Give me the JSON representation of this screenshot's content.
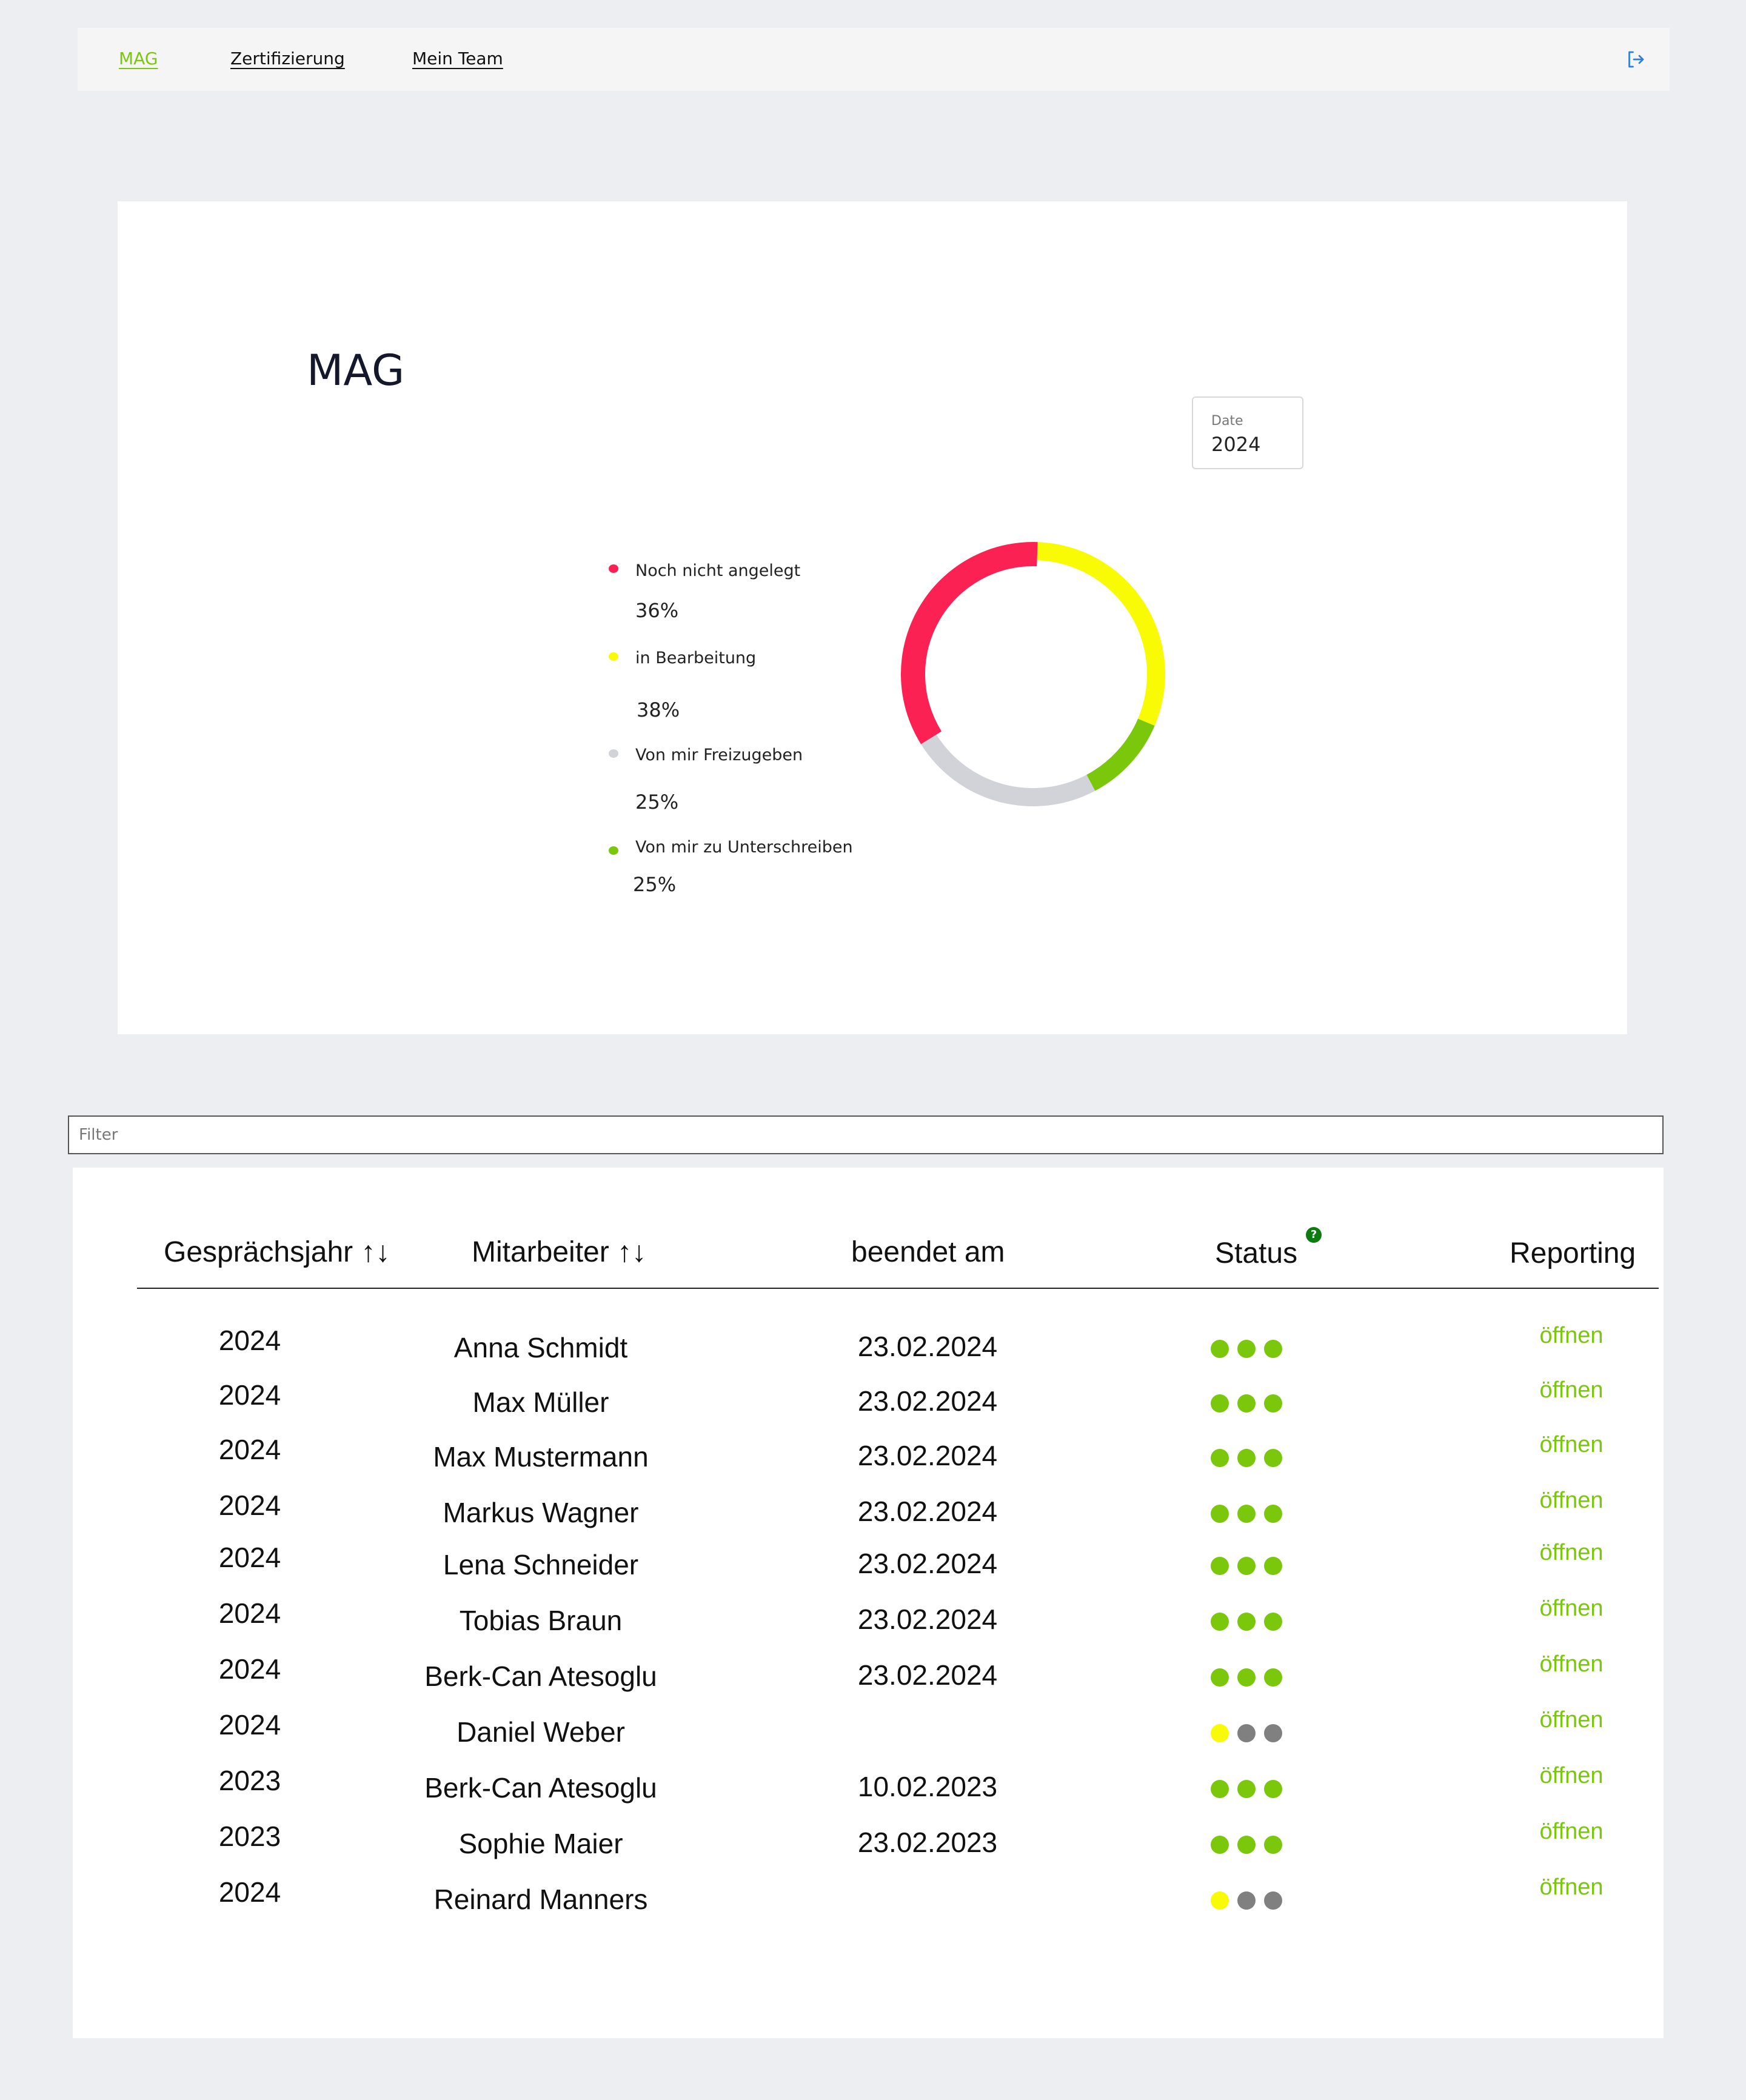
{
  "nav": {
    "items": [
      {
        "label": "MAG",
        "active": true
      },
      {
        "label": "Zertifizierung",
        "active": false
      },
      {
        "label": "Mein Team",
        "active": false
      }
    ],
    "logout_icon": "logout-icon"
  },
  "mag": {
    "title": "MAG",
    "date_label": "Date",
    "date_value": "2024"
  },
  "chart_data": {
    "type": "pie",
    "donut": true,
    "segments": [
      {
        "label": "Noch nicht angelegt",
        "value_label": "36%",
        "value": 36,
        "color": "#fc2153"
      },
      {
        "label": "in Bearbeitung",
        "value_label": "38%",
        "value": 38,
        "color": "#f9fb04"
      },
      {
        "label": "Von mir Freizugeben",
        "value_label": "25%",
        "value": 25,
        "color": "#d1d3d8"
      },
      {
        "label": "Von mir zu Unterschreiben",
        "value_label": "25%",
        "value": 25,
        "color": "#7ac70c"
      }
    ]
  },
  "filter": {
    "placeholder": "Filter",
    "value": ""
  },
  "table": {
    "columns": [
      {
        "label": "Gesprächsjahr ↑↓"
      },
      {
        "label": "Mitarbeiter ↑↓"
      },
      {
        "label": "beendet am"
      },
      {
        "label": "Status"
      },
      {
        "label": "Reporting"
      }
    ],
    "help_badge": "?",
    "rows": [
      {
        "year": "2024",
        "name": "Anna Schmidt",
        "date": "23.02.2024",
        "status": [
          "green",
          "green",
          "green"
        ],
        "action": "öffnen"
      },
      {
        "year": "2024",
        "name": "Max Müller",
        "date": "23.02.2024",
        "status": [
          "green",
          "green",
          "green"
        ],
        "action": "öffnen"
      },
      {
        "year": "2024",
        "name": "Max Mustermann",
        "date": "23.02.2024",
        "status": [
          "green",
          "green",
          "green"
        ],
        "action": "öffnen"
      },
      {
        "year": "2024",
        "name": "Markus Wagner",
        "date": "23.02.2024",
        "status": [
          "green",
          "green",
          "green"
        ],
        "action": "öffnen"
      },
      {
        "year": "2024",
        "name": "Lena Schneider",
        "date": "23.02.2024",
        "status": [
          "green",
          "green",
          "green"
        ],
        "action": "öffnen"
      },
      {
        "year": "2024",
        "name": "Tobias Braun",
        "date": "23.02.2024",
        "status": [
          "green",
          "green",
          "green"
        ],
        "action": "öffnen"
      },
      {
        "year": "2024",
        "name": "Berk-Can Atesoglu",
        "date": "23.02.2024",
        "status": [
          "green",
          "green",
          "green"
        ],
        "action": "öffnen"
      },
      {
        "year": "2024",
        "name": "Daniel Weber",
        "date": "",
        "status": [
          "yellow",
          "gray",
          "gray"
        ],
        "action": "öffnen"
      },
      {
        "year": "2023",
        "name": "Berk-Can Atesoglu",
        "date": "10.02.2023",
        "status": [
          "green",
          "green",
          "green"
        ],
        "action": "öffnen"
      },
      {
        "year": "2023",
        "name": "Sophie Maier",
        "date": "23.02.2023",
        "status": [
          "green",
          "green",
          "green"
        ],
        "action": "öffnen"
      },
      {
        "year": "2024",
        "name": "Reinard Manners",
        "date": "",
        "status": [
          "yellow",
          "gray",
          "gray"
        ],
        "action": "öffnen"
      }
    ]
  },
  "colors": {
    "accent": "#7ac70c",
    "status_green": "#7ac70c",
    "status_yellow": "#f9fb04",
    "status_gray": "#808080",
    "help_badge": "#0e7a12"
  }
}
